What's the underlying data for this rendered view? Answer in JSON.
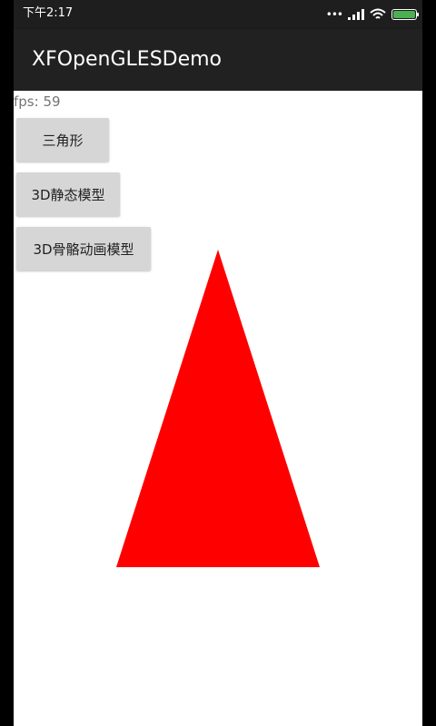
{
  "status_bar": {
    "time": "下午2:17",
    "signal_icon": "signal-bars-icon",
    "wifi_icon": "wifi-icon",
    "battery_icon": "battery-icon",
    "battery_color": "#4caf50"
  },
  "app": {
    "title": "XFOpenGLESDemo"
  },
  "fps_label": "fps: 59",
  "buttons": [
    {
      "label": "三角形"
    },
    {
      "label": "3D静态模型"
    },
    {
      "label": "3D骨骼动画模型"
    }
  ],
  "scene": {
    "shape": "triangle",
    "color": "#ff0000"
  }
}
